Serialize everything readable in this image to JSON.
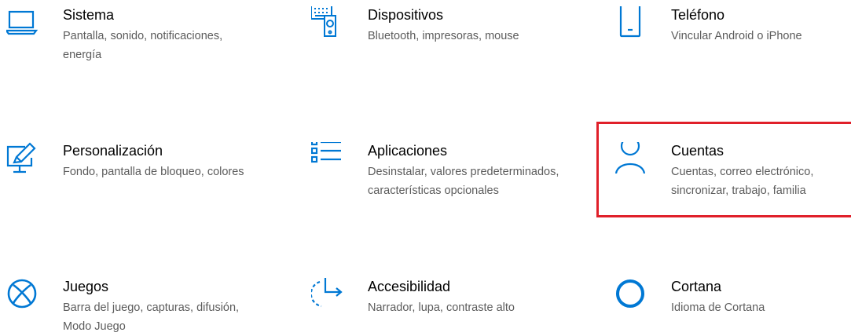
{
  "settings": {
    "tiles": [
      {
        "title": "Sistema",
        "desc": "Pantalla, sonido, notificaciones, energía",
        "icon": "laptop-icon"
      },
      {
        "title": "Dispositivos",
        "desc": "Bluetooth, impresoras, mouse",
        "icon": "devices-icon"
      },
      {
        "title": "Teléfono",
        "desc": "Vincular Android o iPhone",
        "icon": "phone-icon"
      },
      {
        "title": "Personalización",
        "desc": "Fondo, pantalla de bloqueo, colores",
        "icon": "personalization-icon"
      },
      {
        "title": "Aplicaciones",
        "desc": "Desinstalar, valores predeterminados, características opcionales",
        "icon": "apps-list-icon"
      },
      {
        "title": "Cuentas",
        "desc": "Cuentas, correo electrónico, sincronizar, trabajo, familia",
        "icon": "person-icon"
      },
      {
        "title": "Juegos",
        "desc": "Barra del juego, capturas, difusión, Modo Juego",
        "icon": "xbox-icon"
      },
      {
        "title": "Accesibilidad",
        "desc": "Narrador, lupa, contraste alto",
        "icon": "accessibility-icon"
      },
      {
        "title": "Cortana",
        "desc": "Idioma de Cortana",
        "icon": "cortana-icon"
      }
    ]
  },
  "colors": {
    "accent": "#0078d4",
    "highlight": "#e0202a",
    "title": "#000000",
    "description": "#5c5c5c"
  }
}
